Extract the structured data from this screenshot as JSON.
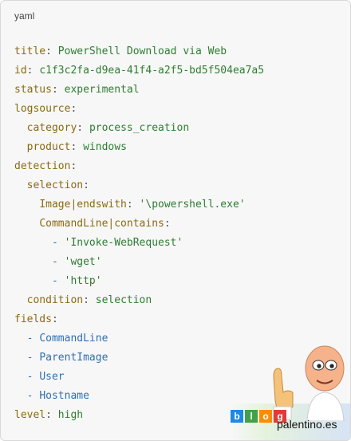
{
  "code_block": {
    "language_label": "yaml",
    "lines": [
      {
        "indent": 0,
        "parts": [
          {
            "t": "title",
            "c": "k"
          },
          {
            "t": ": ",
            "c": "p"
          },
          {
            "t": "PowerShell Download via Web",
            "c": "v"
          }
        ]
      },
      {
        "indent": 0,
        "parts": [
          {
            "t": "id",
            "c": "k"
          },
          {
            "t": ": ",
            "c": "p"
          },
          {
            "t": "c1f3c2fa-d9ea-41f4-a2f5-bd5f504ea7a5",
            "c": "v"
          }
        ]
      },
      {
        "indent": 0,
        "parts": [
          {
            "t": "status",
            "c": "k"
          },
          {
            "t": ": ",
            "c": "p"
          },
          {
            "t": "experimental",
            "c": "v"
          }
        ]
      },
      {
        "indent": 0,
        "parts": [
          {
            "t": "logsource",
            "c": "k"
          },
          {
            "t": ":",
            "c": "p"
          }
        ]
      },
      {
        "indent": 2,
        "parts": [
          {
            "t": "category",
            "c": "k"
          },
          {
            "t": ": ",
            "c": "p"
          },
          {
            "t": "process_creation",
            "c": "v"
          }
        ]
      },
      {
        "indent": 2,
        "parts": [
          {
            "t": "product",
            "c": "k"
          },
          {
            "t": ": ",
            "c": "p"
          },
          {
            "t": "windows",
            "c": "v"
          }
        ]
      },
      {
        "indent": 0,
        "parts": [
          {
            "t": "detection",
            "c": "k"
          },
          {
            "t": ":",
            "c": "p"
          }
        ]
      },
      {
        "indent": 2,
        "parts": [
          {
            "t": "selection",
            "c": "k"
          },
          {
            "t": ":",
            "c": "p"
          }
        ]
      },
      {
        "indent": 4,
        "parts": [
          {
            "t": "Image|endswith",
            "c": "k"
          },
          {
            "t": ": ",
            "c": "p"
          },
          {
            "t": "'\\powershell.exe'",
            "c": "v"
          }
        ]
      },
      {
        "indent": 4,
        "parts": [
          {
            "t": "CommandLine|contains",
            "c": "k"
          },
          {
            "t": ":",
            "c": "p"
          }
        ]
      },
      {
        "indent": 6,
        "parts": [
          {
            "t": "- ",
            "c": "d"
          },
          {
            "t": "'Invoke-WebRequest'",
            "c": "v"
          }
        ]
      },
      {
        "indent": 6,
        "parts": [
          {
            "t": "- ",
            "c": "d"
          },
          {
            "t": "'wget'",
            "c": "v"
          }
        ]
      },
      {
        "indent": 6,
        "parts": [
          {
            "t": "- ",
            "c": "d"
          },
          {
            "t": "'http'",
            "c": "v"
          }
        ]
      },
      {
        "indent": 2,
        "parts": [
          {
            "t": "condition",
            "c": "k"
          },
          {
            "t": ": ",
            "c": "p"
          },
          {
            "t": "selection",
            "c": "v"
          }
        ]
      },
      {
        "indent": 0,
        "parts": [
          {
            "t": "fields",
            "c": "k"
          },
          {
            "t": ":",
            "c": "p"
          }
        ]
      },
      {
        "indent": 2,
        "parts": [
          {
            "t": "- ",
            "c": "d"
          },
          {
            "t": "CommandLine",
            "c": "d"
          }
        ]
      },
      {
        "indent": 2,
        "parts": [
          {
            "t": "- ",
            "c": "d"
          },
          {
            "t": "ParentImage",
            "c": "d"
          }
        ]
      },
      {
        "indent": 2,
        "parts": [
          {
            "t": "- ",
            "c": "d"
          },
          {
            "t": "User",
            "c": "d"
          }
        ]
      },
      {
        "indent": 2,
        "parts": [
          {
            "t": "- ",
            "c": "d"
          },
          {
            "t": "Hostname",
            "c": "d"
          }
        ]
      },
      {
        "indent": 0,
        "parts": [
          {
            "t": "level",
            "c": "k"
          },
          {
            "t": ": ",
            "c": "p"
          },
          {
            "t": "high",
            "c": "v"
          }
        ]
      }
    ]
  },
  "watermark": {
    "text": "palentino.es",
    "badge_letters": [
      {
        "char": "b",
        "color": "#1e88e5"
      },
      {
        "char": "l",
        "color": "#43a047"
      },
      {
        "char": "o",
        "color": "#fb8c00"
      },
      {
        "char": "g",
        "color": "#e53935"
      }
    ]
  },
  "colors": {
    "key": "#8a6a10",
    "value": "#2e7d32",
    "dash": "#2f6fb3",
    "punct": "#555555",
    "background": "#f7f7f7"
  }
}
